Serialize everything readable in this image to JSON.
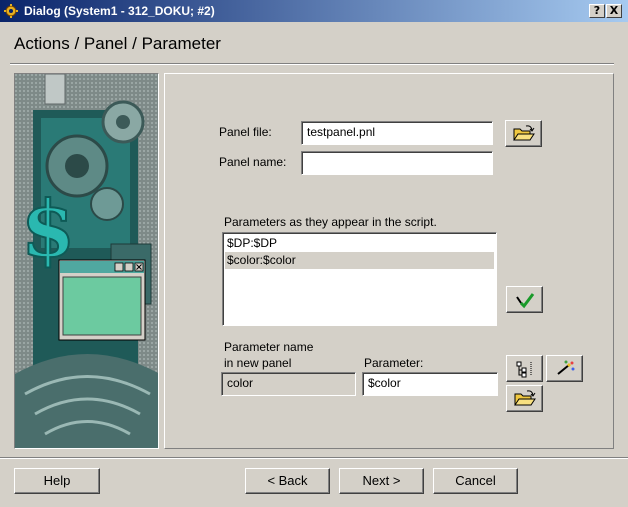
{
  "window": {
    "title": "Dialog (System1 - 312_DOKU; #2)",
    "help_glyph": "?",
    "close_glyph": "X"
  },
  "heading": "Actions / Panel / Parameter",
  "illustration": {
    "dollar_glyph": "$"
  },
  "form": {
    "panel_file_label": "Panel file:",
    "panel_file_value": "testpanel.pnl",
    "panel_name_label": "Panel name:",
    "panel_name_value": "",
    "params_label": "Parameters as they appear in the script.",
    "params": [
      {
        "text": "$DP:$DP"
      },
      {
        "text": "$color:$color"
      }
    ],
    "param_name_label_line1": "Parameter name",
    "param_name_label_line2": "in new panel",
    "param_name_value": "color",
    "parameter_label": "Parameter:",
    "parameter_value": "$color"
  },
  "buttons": {
    "help": "Help",
    "back": "< Back",
    "next": "Next >",
    "cancel": "Cancel"
  },
  "colors": {
    "titlebar_start": "#0a246a",
    "titlebar_end": "#a6caf0",
    "face": "#d4d0c8",
    "teal": "#2aa8a0",
    "check_green": "#1a9a2a",
    "folder_yellow": "#f0c840"
  }
}
